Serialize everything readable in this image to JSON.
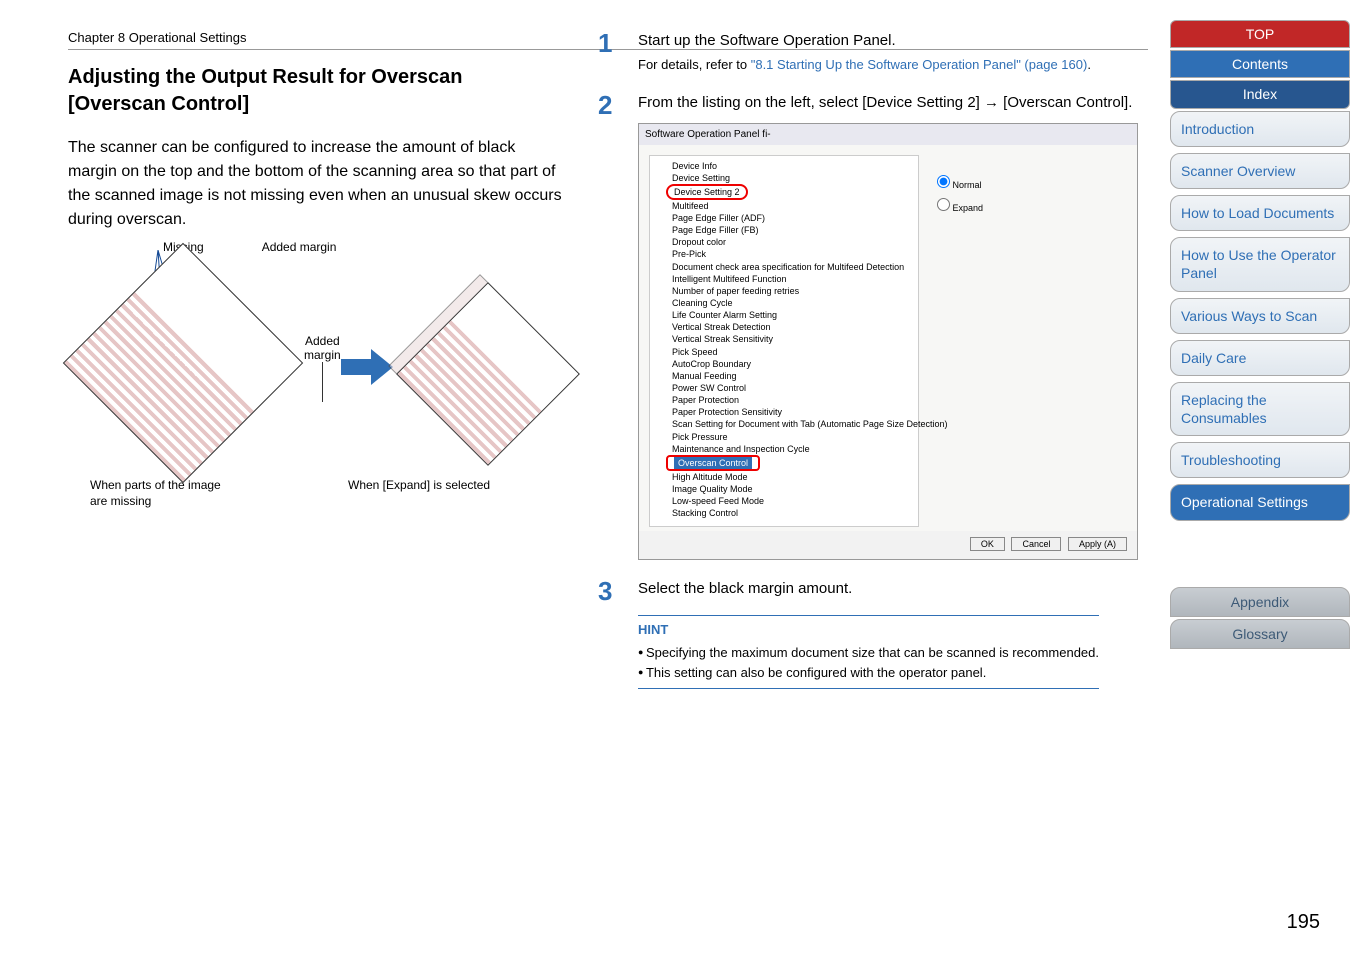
{
  "chapter": "Chapter 8 Operational Settings",
  "section_title_1": "Adjusting the Output Result for Overscan",
  "section_title_2": "[Overscan Control]",
  "intro_text": "The scanner can be configured to increase the amount of black margin on the top and the bottom of the scanning area so that part of the scanned image is not missing even when an unusual skew occurs during overscan.",
  "diagram": {
    "missing_label": "Missing",
    "added_margin_label": "Added margin",
    "added_label_block_1": "Added",
    "added_label_block_2": "margin",
    "caption_left_1": "When parts of the image",
    "caption_left_2": "are missing",
    "caption_right": "When [Expand] is selected"
  },
  "steps": {
    "s1_main": "Start up the Software Operation Panel.",
    "s1_detail_prefix": "For details, refer to ",
    "s1_link": "\"8.1 Starting Up the Software Operation Panel\" (page 160)",
    "s1_detail_suffix": ".",
    "s2_main_prefix": "From the listing on the left, select [Device Setting 2] ",
    "s2_main_arrow": "→",
    "s2_main_suffix": " [Overscan Control].",
    "s3_main": "Select the black margin amount."
  },
  "sop": {
    "title": "Software Operation Panel fi-",
    "tree": [
      "Device Info",
      "Device Setting",
      "Device Setting 2",
      "Multifeed",
      "Page Edge Filler (ADF)",
      "Page Edge Filler (FB)",
      "Dropout color",
      "Pre-Pick",
      "Document check area specification for Multifeed Detection",
      "Intelligent Multifeed Function",
      "Number of paper feeding retries",
      "Cleaning Cycle",
      "Life Counter Alarm Setting",
      "Vertical Streak Detection",
      "Vertical Streak Sensitivity",
      "Pick Speed",
      "AutoCrop Boundary",
      "Manual Feeding",
      "Power SW Control",
      "Paper Protection",
      "Paper Protection Sensitivity",
      "Scan Setting for Document with Tab (Automatic Page Size Detection)",
      "Pick Pressure",
      "Maintenance and Inspection Cycle",
      "Overscan Control",
      "High Altitude Mode",
      "Image Quality Mode",
      "Low-speed Feed Mode",
      "Stacking Control"
    ],
    "radio_normal": "Normal",
    "radio_expand": "Expand",
    "btn_ok": "OK",
    "btn_cancel": "Cancel",
    "btn_apply": "Apply (A)"
  },
  "hint": {
    "title": "HINT",
    "items": [
      "Specifying the maximum document size that can be scanned is recommended.",
      "This setting can also be configured with the operator panel."
    ]
  },
  "sidebar": {
    "top": "TOP",
    "contents": "Contents",
    "index": "Index",
    "introduction": "Introduction",
    "scanner_overview": "Scanner Overview",
    "how_to_load": "How to Load Documents",
    "operator_panel": "How to Use the Operator Panel",
    "various_ways": "Various Ways to Scan",
    "daily_care": "Daily Care",
    "consumables": "Replacing the Consumables",
    "troubleshooting": "Troubleshooting",
    "operational": "Operational Settings",
    "appendix": "Appendix",
    "glossary": "Glossary"
  },
  "page_number": "195"
}
